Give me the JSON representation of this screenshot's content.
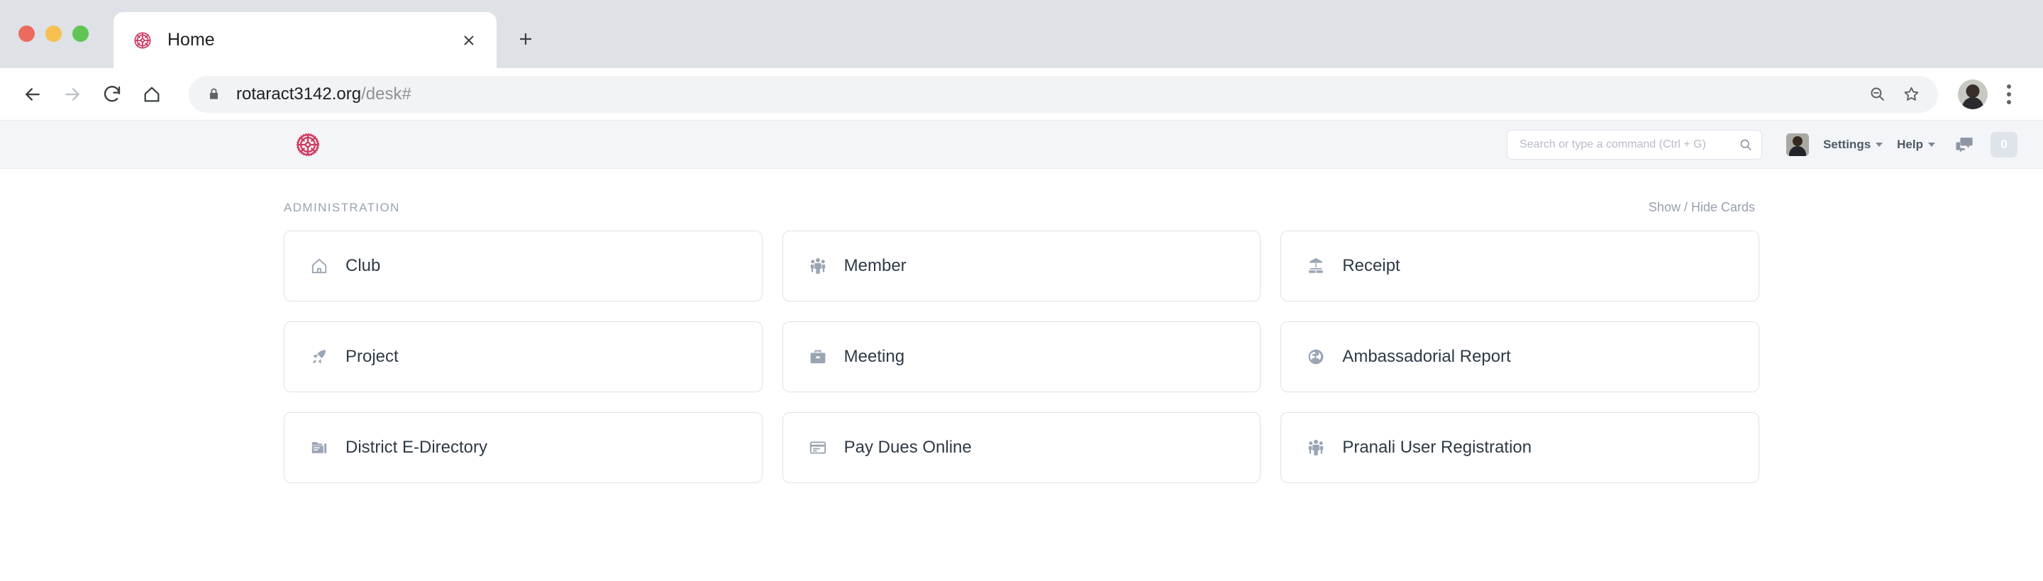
{
  "browser": {
    "tab": {
      "title": "Home",
      "favicon": "rotary-wheel-icon",
      "close_label": "×"
    },
    "new_tab_label": "+",
    "nav": {
      "back": "back-arrow",
      "forward": "forward-arrow",
      "reload": "reload-icon",
      "home": "home-icon"
    },
    "omnibox": {
      "lock": "lock-icon",
      "url_domain": "rotaract3142.org",
      "url_path": "/desk#",
      "zoom_icon": "zoom-out-icon",
      "bookmark_icon": "star-icon"
    },
    "profile": "profile-avatar",
    "menu": "three-dot-menu"
  },
  "app_header": {
    "logo": "rotary-wheel-logo",
    "search": {
      "value": "",
      "placeholder": "Search or type a command (Ctrl + G)",
      "icon": "search-icon"
    },
    "avatar": "user-avatar",
    "settings_label": "Settings",
    "help_label": "Help",
    "chat_icon": "chat-bubbles-icon",
    "notification_count": "0"
  },
  "main": {
    "section_title": "ADMINISTRATION",
    "toggle_cards_label": "Show / Hide Cards",
    "cards": [
      {
        "label": "Club",
        "icon": "home-outline-icon"
      },
      {
        "label": "Member",
        "icon": "people-group-icon"
      },
      {
        "label": "Receipt",
        "icon": "bank-building-icon"
      },
      {
        "label": "Project",
        "icon": "rocket-icon"
      },
      {
        "label": "Meeting",
        "icon": "briefcase-icon"
      },
      {
        "label": "Ambassadorial Report",
        "icon": "globe-icon"
      },
      {
        "label": "District E-Directory",
        "icon": "folder-icon"
      },
      {
        "label": "Pay Dues Online",
        "icon": "credit-card-icon"
      },
      {
        "label": "Pranali User Registration",
        "icon": "people-group-icon"
      }
    ]
  },
  "colors": {
    "brand": "#cf3b62",
    "chrome_bg": "#dee1e6",
    "header_bg": "#f4f5f8",
    "card_border": "#dfe2e9",
    "text": "#2f3a46",
    "muted": "#9aa3b2"
  }
}
